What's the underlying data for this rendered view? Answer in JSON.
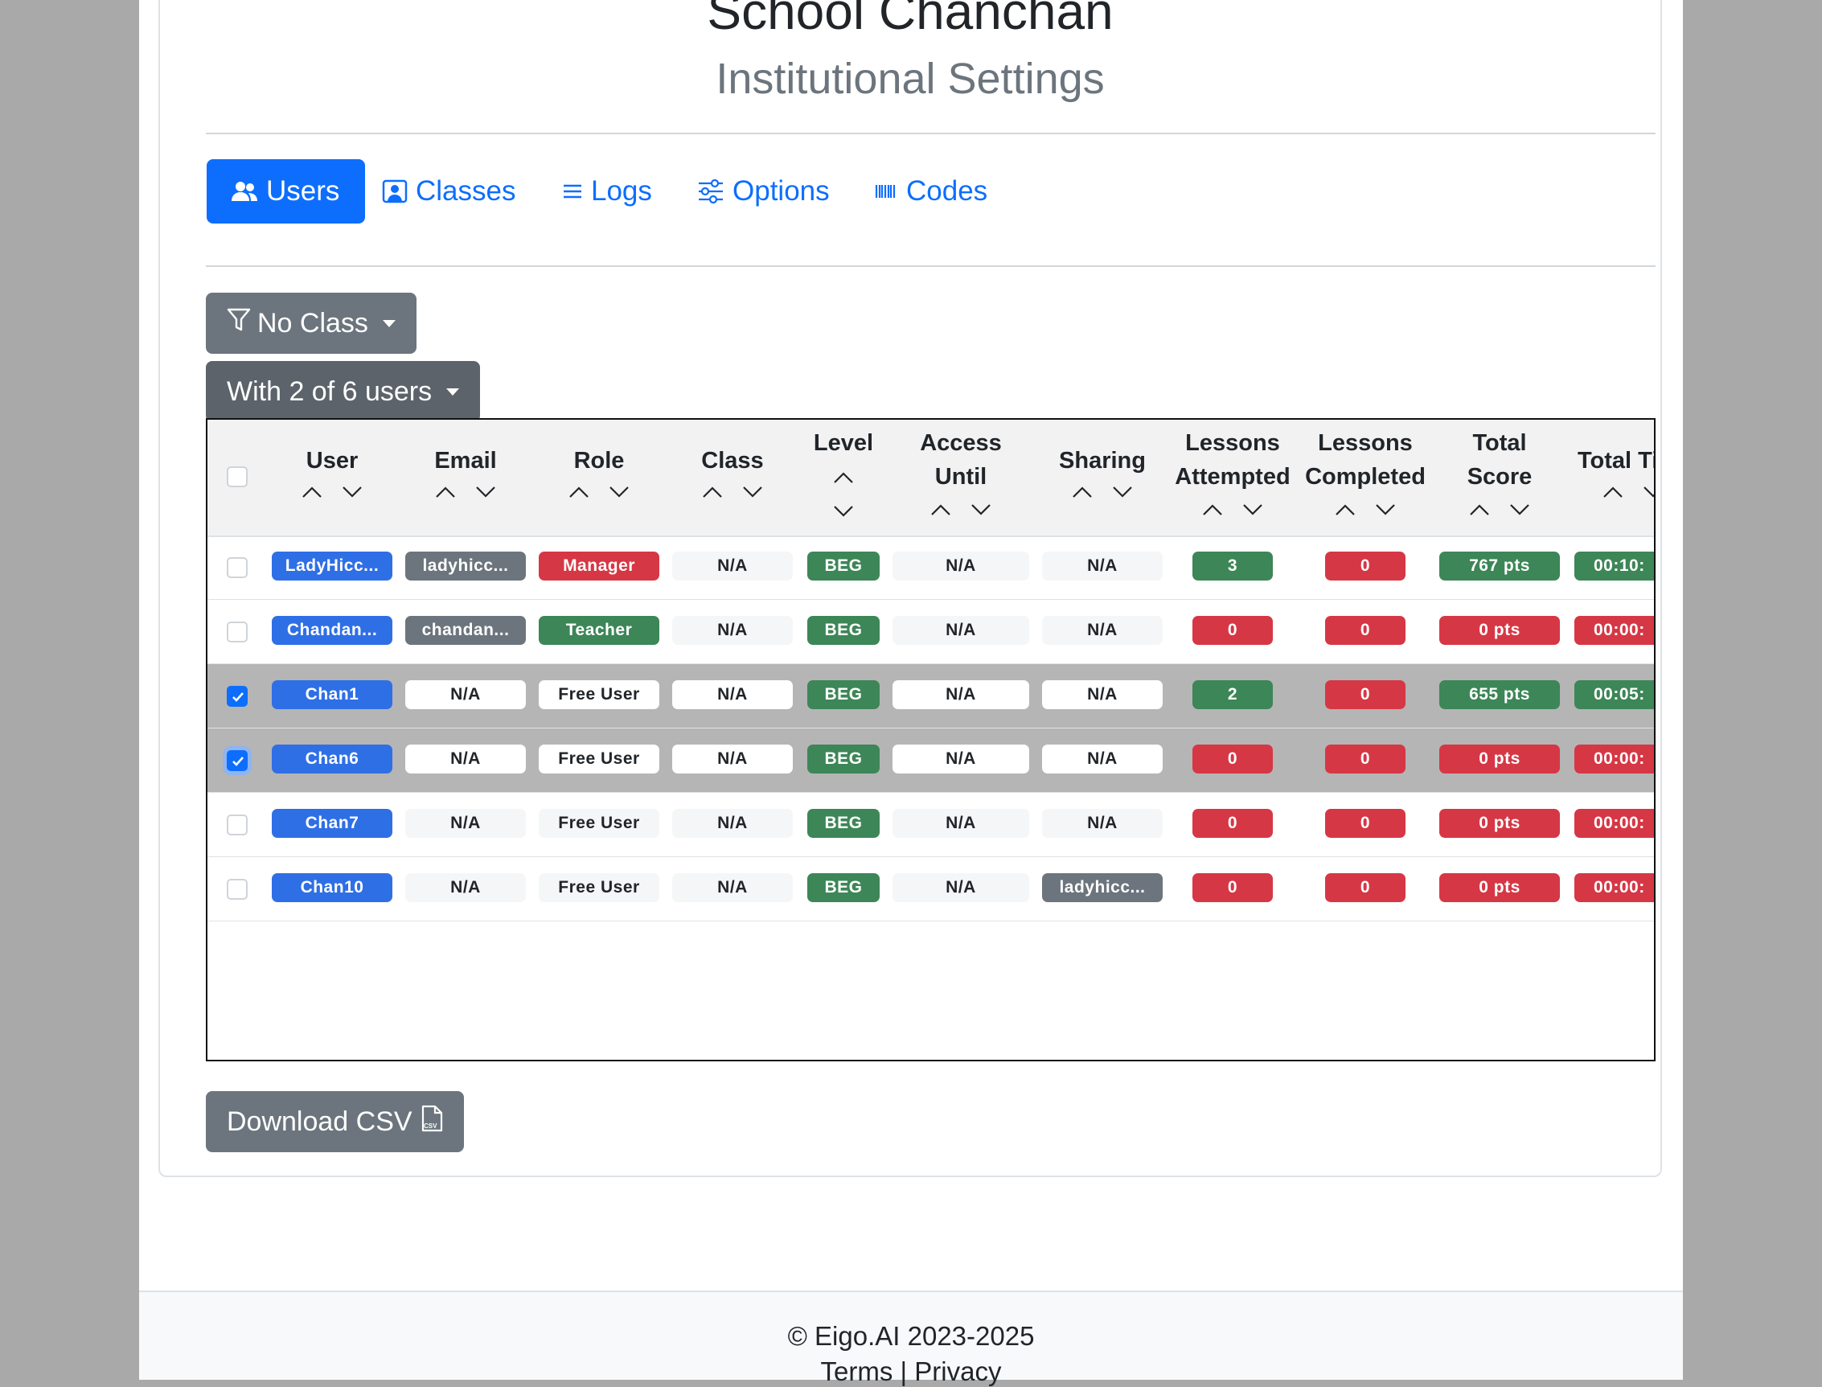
{
  "header": {
    "school": "School Chanchan",
    "subtitle": "Institutional Settings"
  },
  "tabs": [
    {
      "label": "Users",
      "icon": "users-icon",
      "active": true
    },
    {
      "label": "Classes",
      "icon": "classes-icon",
      "active": false
    },
    {
      "label": "Logs",
      "icon": "list-icon",
      "active": false
    },
    {
      "label": "Options",
      "icon": "sliders-icon",
      "active": false
    },
    {
      "label": "Codes",
      "icon": "barcode-icon",
      "active": false
    }
  ],
  "filter": {
    "class_label": "No Class",
    "selection_label": "With 2 of 6 users"
  },
  "table": {
    "columns": [
      "User",
      "Email",
      "Role",
      "Class",
      "Level",
      "Access Until",
      "Sharing",
      "Lessons Attempted",
      "Lessons Completed",
      "Total Score",
      "Total Ti"
    ],
    "rows": [
      {
        "checked": false,
        "user": "LadyHicc...",
        "email": "ladyhicc...",
        "role": "Manager",
        "class": "N/A",
        "level": "BEG",
        "access": "N/A",
        "sharing": "N/A",
        "attempted": "3",
        "completed": "0",
        "score": "767 pts",
        "time": "00:10:"
      },
      {
        "checked": false,
        "user": "Chandan...",
        "email": "chandan...",
        "role": "Teacher",
        "class": "N/A",
        "level": "BEG",
        "access": "N/A",
        "sharing": "N/A",
        "attempted": "0",
        "completed": "0",
        "score": "0 pts",
        "time": "00:00:"
      },
      {
        "checked": true,
        "user": "Chan1",
        "email": "N/A",
        "role": "Free User",
        "class": "N/A",
        "level": "BEG",
        "access": "N/A",
        "sharing": "N/A",
        "attempted": "2",
        "completed": "0",
        "score": "655 pts",
        "time": "00:05:"
      },
      {
        "checked": true,
        "user": "Chan6",
        "email": "N/A",
        "role": "Free User",
        "class": "N/A",
        "level": "BEG",
        "access": "N/A",
        "sharing": "N/A",
        "attempted": "0",
        "completed": "0",
        "score": "0 pts",
        "time": "00:00:"
      },
      {
        "checked": false,
        "user": "Chan7",
        "email": "N/A",
        "role": "Free User",
        "class": "N/A",
        "level": "BEG",
        "access": "N/A",
        "sharing": "N/A",
        "attempted": "0",
        "completed": "0",
        "score": "0 pts",
        "time": "00:00:"
      },
      {
        "checked": false,
        "user": "Chan10",
        "email": "N/A",
        "role": "Free User",
        "class": "N/A",
        "level": "BEG",
        "access": "N/A",
        "sharing": "ladyhicc...",
        "attempted": "0",
        "completed": "0",
        "score": "0 pts",
        "time": "00:00:"
      }
    ]
  },
  "download": {
    "label": "Download CSV",
    "icon": "csv-file-icon"
  },
  "footer": {
    "copyright": "© Eigo.AI 2023-2025",
    "links": "Terms | Privacy"
  },
  "colors": {
    "primary": "#0d6efd",
    "secondary": "#6c757d",
    "success": "#3d8657",
    "danger": "#d63745"
  }
}
